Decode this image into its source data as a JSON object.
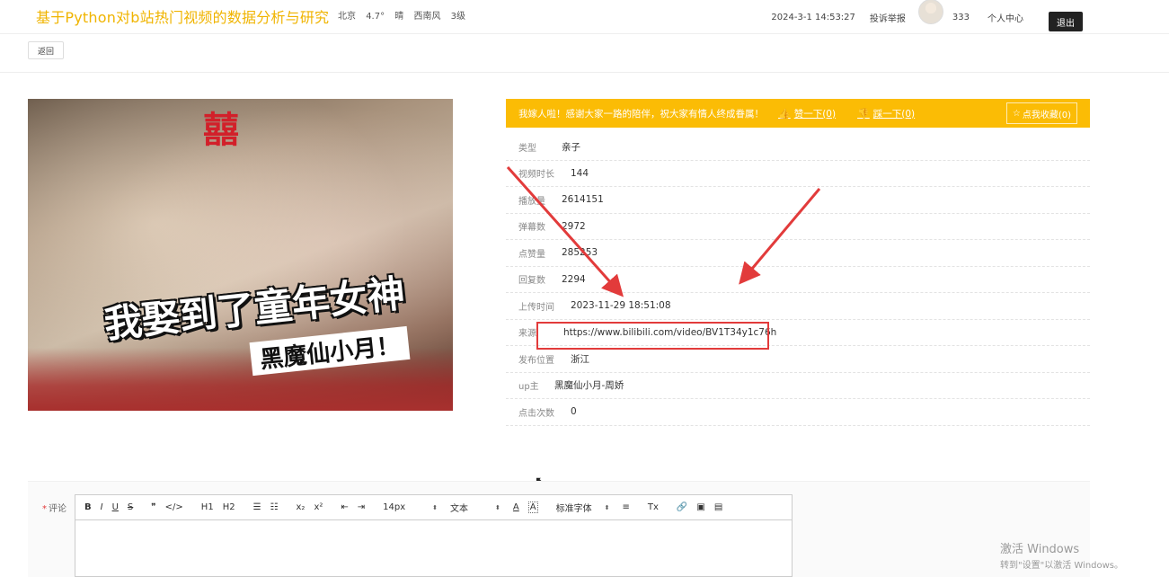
{
  "header": {
    "site_title": "基于Python对b站热门视频的数据分析与研究",
    "weather": {
      "city": "北京",
      "temp": "4.7°",
      "condition": "晴",
      "wind": "西南风",
      "level": "3级"
    },
    "datetime": "2024-3-1 14:53:27",
    "report_label": "投诉举报",
    "user_id": "333",
    "user_center_label": "个人中心",
    "logout_label": "退出"
  },
  "back_label": "返回",
  "cover": {
    "caption_main": "我娶到了童年女神",
    "caption_sub": "黑魔仙小月！",
    "xi_char": "囍"
  },
  "notice": {
    "message": "我嫁人啦！感谢大家一路的陪伴，祝大家有情人终成眷属！",
    "like_label": "赞一下(0)",
    "dislike_label": "踩一下(0)",
    "favorite_label": "点我收藏(0)"
  },
  "details": [
    {
      "label": "类型",
      "value": "亲子"
    },
    {
      "label": "视频时长",
      "value": "144"
    },
    {
      "label": "播放量",
      "value": "2614151"
    },
    {
      "label": "弹幕数",
      "value": "2972"
    },
    {
      "label": "点赞量",
      "value": "285253"
    },
    {
      "label": "回复数",
      "value": "2294"
    },
    {
      "label": "上传时间",
      "value": "2023-11-29 18:51:08"
    },
    {
      "label": "来源",
      "value": "https://www.bilibili.com/video/BV1T34y1c76h"
    },
    {
      "label": "发布位置",
      "value": "浙江"
    },
    {
      "label": "up主",
      "value": "黑魔仙小月-周娇"
    },
    {
      "label": "点击次数",
      "value": "0"
    }
  ],
  "comment": {
    "required_mark": "*",
    "label": "评论",
    "toolbar": {
      "bold": "B",
      "italic": "I",
      "underline": "U",
      "strike": "S",
      "quote": "❞",
      "code": "</>",
      "h1": "H1",
      "h2": "H2",
      "ordered": "☰",
      "bullet": "☷",
      "sub": "x₂",
      "sup": "x²",
      "outdent": "⇤",
      "indent": "⇥",
      "size_value": "14px",
      "style_value": "文本",
      "font_value": "标准字体",
      "color": "A",
      "bg": "A",
      "align": "≡",
      "clear": "Tx",
      "link": "🔗",
      "image": "▣",
      "video": "▤"
    }
  },
  "watermark": {
    "line1": "激活 Windows",
    "line2": "转到\"设置\"以激活 Windows。"
  },
  "colors": {
    "accent": "#fbbc05",
    "title": "#f0b400",
    "highlight": "#e23b3b"
  }
}
